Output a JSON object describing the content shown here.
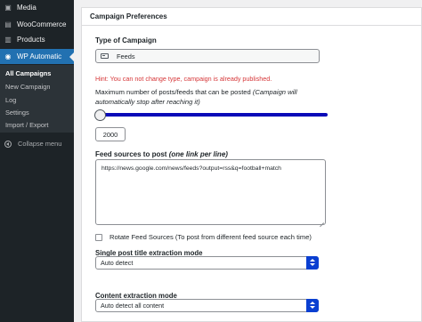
{
  "sidebar": {
    "items": [
      {
        "label": "Media",
        "icon": "media-icon"
      },
      {
        "label": "WooCommerce",
        "icon": "woocommerce-icon"
      },
      {
        "label": "Products",
        "icon": "products-icon"
      },
      {
        "label": "WP Automatic",
        "icon": "automatic-icon"
      }
    ],
    "submenu": [
      "All Campaigns",
      "New Campaign",
      "Log",
      "Settings",
      "Import / Export"
    ],
    "collapse": "Collapse menu",
    "active_color": "#2271b1"
  },
  "panel": {
    "title": "Campaign Preferences",
    "type_label": "Type of Campaign",
    "type_value": "Feeds",
    "hint": "Hint: You can not change type, campaign is already published.",
    "max_label": "Maximum number of posts/feeds that can be posted",
    "max_note": "(Campaign will automatically stop after reaching it)",
    "max_value": "2000",
    "feeds_label": "Feed sources to post",
    "feeds_note": "(one link per line)",
    "feeds_value": "https://news.google.com/news/feeds?output=rss&q=football+match",
    "rotate_label": "Rotate Feed Sources (To post from different feed source each time)",
    "title_mode_label": "Single post title extraction mode",
    "title_mode_value": "Auto detect",
    "content_mode_label": "Content extraction mode",
    "content_mode_value": "Auto detect all content"
  }
}
